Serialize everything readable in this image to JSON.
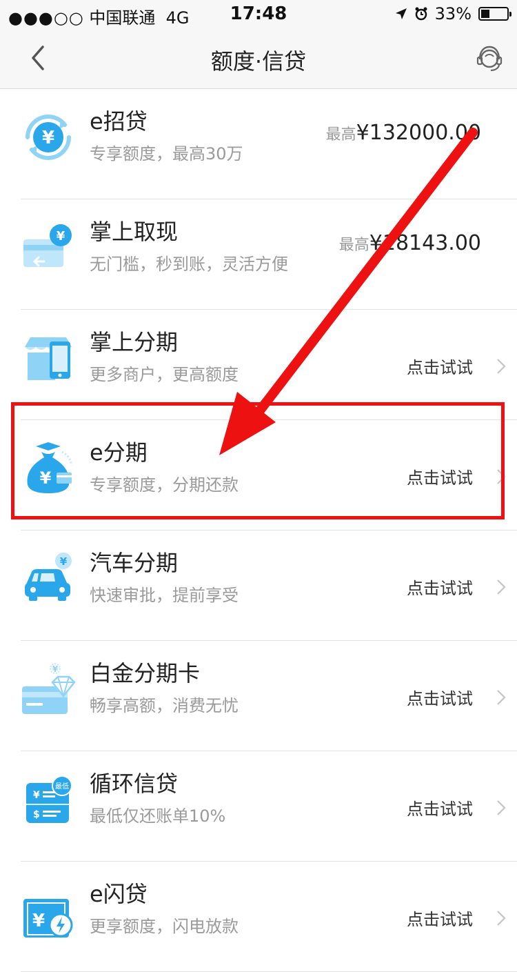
{
  "status_bar": {
    "signal": "●●●○○",
    "carrier": "中国联通",
    "network": "4G",
    "time": "17:48",
    "battery_percent": "33%",
    "battery_level": 0.33
  },
  "nav": {
    "title": "额度·信贷"
  },
  "items": [
    {
      "title": "e招贷",
      "subtitle": "专享额度，最高30万",
      "amount_prefix": "最高",
      "amount": "¥132000.00",
      "icon": "refresh-yen-icon"
    },
    {
      "title": "掌上取现",
      "subtitle": "无门槛，秒到账，灵活方便",
      "amount_prefix": "最高",
      "amount": "¥18143.00",
      "icon": "card-yen-icon"
    },
    {
      "title": "掌上分期",
      "subtitle": "更多商户，更高额度",
      "action": "点击试试",
      "icon": "shop-phone-icon"
    },
    {
      "title": "e分期",
      "subtitle": "专享额度，分期还款",
      "action": "点击试试",
      "icon": "money-bag-icon"
    },
    {
      "title": "汽车分期",
      "subtitle": "快速审批，提前享受",
      "action": "点击试试",
      "icon": "car-yen-icon"
    },
    {
      "title": "白金分期卡",
      "subtitle": "畅享高额，消费无忧",
      "action": "点击试试",
      "icon": "diamond-card-icon"
    },
    {
      "title": "循环信贷",
      "subtitle": "最低仅还账单10%",
      "action": "点击试试",
      "icon": "cycle-bill-icon",
      "badge": "最低"
    },
    {
      "title": "e闪贷",
      "subtitle": "更享额度，闪电放款",
      "action": "点击试试",
      "icon": "flash-loan-icon"
    }
  ],
  "colors": {
    "accent_blue": "#2aa7ea",
    "light_blue": "#8fd3f6",
    "annotation_red": "#ee1111"
  }
}
